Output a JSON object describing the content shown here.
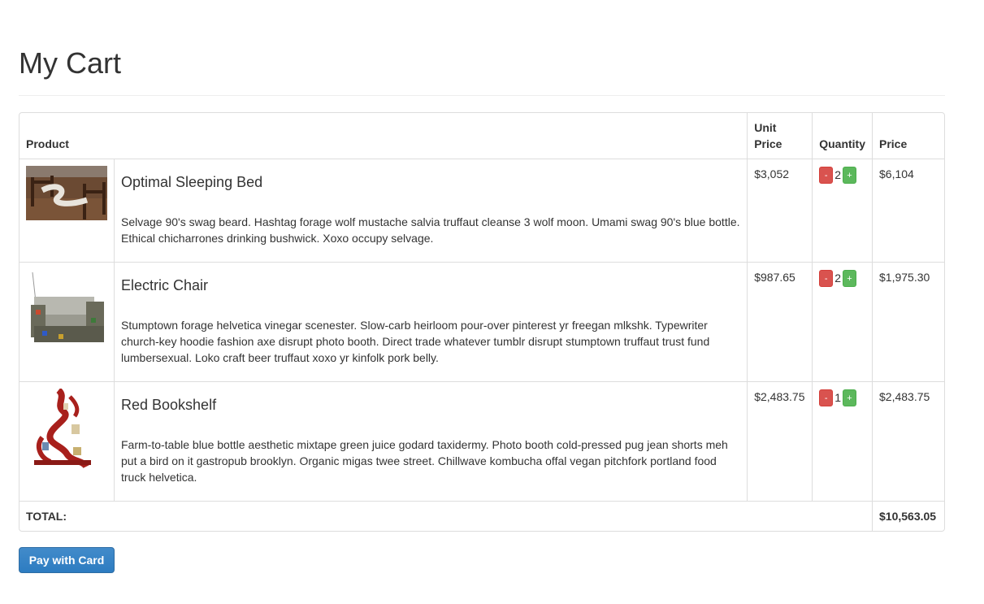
{
  "page": {
    "title": "My Cart"
  },
  "table": {
    "headers": {
      "product": "Product",
      "unit_price": "Unit Price",
      "quantity": "Quantity",
      "price": "Price"
    },
    "items": [
      {
        "image": "bed-image",
        "name": "Optimal Sleeping Bed",
        "description": "Selvage 90's swag beard. Hashtag forage wolf mustache salvia truffaut cleanse 3 wolf moon. Umami swag 90's blue bottle. Ethical chicharrones drinking bushwick. Xoxo occupy selvage.",
        "unit_price": "$3,052",
        "quantity": "2",
        "price": "$6,104"
      },
      {
        "image": "chair-image",
        "name": "Electric Chair",
        "description": "Stumptown forage helvetica vinegar scenester. Slow-carb heirloom pour-over pinterest yr freegan mlkshk. Typewriter church-key hoodie fashion axe disrupt photo booth. Direct trade whatever tumblr disrupt stumptown truffaut trust fund lumbersexual. Loko craft beer truffaut xoxo yr kinfolk pork belly.",
        "unit_price": "$987.65",
        "quantity": "2",
        "price": "$1,975.30"
      },
      {
        "image": "bookshelf-image",
        "name": "Red Bookshelf",
        "description": "Farm-to-table blue bottle aesthetic mixtape green juice godard taxidermy. Photo booth cold-pressed pug jean shorts meh put a bird on it gastropub brooklyn. Organic migas twee street. Chillwave kombucha offal vegan pitchfork portland food truck helvetica.",
        "unit_price": "$2,483.75",
        "quantity": "1",
        "price": "$2,483.75"
      }
    ],
    "minus_label": "-",
    "plus_label": "+",
    "total_label": "TOTAL:",
    "total_value": "$10,563.05"
  },
  "actions": {
    "pay_label": "Pay with Card"
  },
  "colors": {
    "minus": "#d9534f",
    "plus": "#5cb85c",
    "primary": "#337ab7"
  }
}
